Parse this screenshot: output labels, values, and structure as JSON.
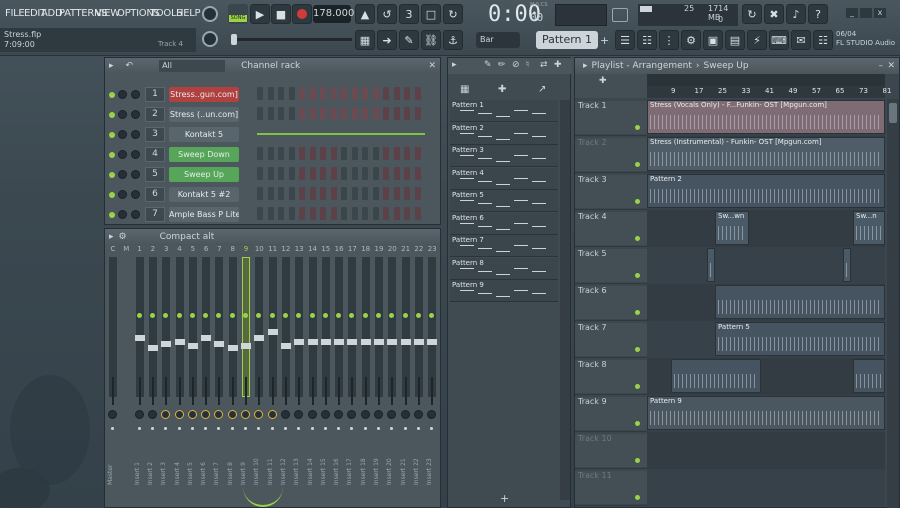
{
  "menu": [
    "FILE",
    "EDIT",
    "ADD",
    "PATTERNS",
    "VIEW",
    "OPTIONS",
    "TOOLS",
    "HELP"
  ],
  "song_badge": "SONG",
  "tempo": "178.000",
  "time": "0:00",
  "time_sub": "00",
  "time_unit": "M:S:CS",
  "cpu": "25",
  "mem": "1714 MB",
  "mem_sub": "0",
  "file": {
    "name": "Stress.flp",
    "time": "7:09:00",
    "track": "Track 4"
  },
  "snap": "Bar",
  "pattern_sel": "Pattern 1",
  "news": {
    "date": "06/04",
    "text": "FL STUDIO Audio f..."
  },
  "channel_rack": {
    "title": "Channel rack",
    "filter": "All",
    "channels": [
      {
        "num": "1",
        "name": "Stress..gun.com]",
        "color": "#b0413f"
      },
      {
        "num": "2",
        "name": "Stress (..un.com]",
        "color": "#59656c"
      },
      {
        "num": "3",
        "name": "Kontakt 5",
        "color": "#59656c"
      },
      {
        "num": "4",
        "name": "Sweep Down",
        "color": "#56a558"
      },
      {
        "num": "5",
        "name": "Sweep Up",
        "color": "#56a558"
      },
      {
        "num": "6",
        "name": "Kontakt 5 #2",
        "color": "#59656c"
      },
      {
        "num": "7",
        "name": "Ample Bass P Lite II",
        "color": "#59656c"
      }
    ]
  },
  "mixer": {
    "title": "Compact alt",
    "headers": [
      "C",
      "M",
      "1",
      "2",
      "3",
      "4",
      "5",
      "6",
      "7",
      "8",
      "9",
      "10",
      "11",
      "12",
      "13",
      "14",
      "15",
      "16",
      "17",
      "18",
      "19",
      "20",
      "21",
      "22",
      "23"
    ],
    "labels": [
      "Master",
      "Insert 1",
      "Insert 2",
      "Insert 3",
      "Insert 4",
      "Insert 5",
      "Insert 6",
      "Insert 7",
      "Insert 8",
      "Insert 9",
      "Insert 10",
      "Insert 11",
      "Insert 12",
      "Insert 13",
      "Insert 14",
      "Insert 15",
      "Insert 16",
      "Insert 17",
      "Insert 18",
      "Insert 19",
      "Insert 20",
      "Insert 21",
      "Insert 22",
      "Insert 23"
    ]
  },
  "patterns": [
    "Pattern 1",
    "Pattern 2",
    "Pattern 3",
    "Pattern 4",
    "Pattern 5",
    "Pattern 6",
    "Pattern 7",
    "Pattern 8",
    "Pattern 9"
  ],
  "playlist": {
    "title": "Playlist - Arrangement",
    "breadcrumb": "Sweep Up",
    "ruler": [
      "9",
      "17",
      "25",
      "33",
      "41",
      "49",
      "57",
      "65",
      "73",
      "81"
    ],
    "tracks": [
      "Track 1",
      "Track 2",
      "Track 3",
      "Track 4",
      "Track 5",
      "Track 6",
      "Track 7",
      "Track 8",
      "Track 9",
      "Track 10",
      "Track 11"
    ],
    "clips": {
      "t1": "Stress (Vocals Only) - F...Funkin- OST [Mpgun.com]",
      "t1b": "S...om]",
      "t2": "Stress (Instrumental) - Funkin- OST [Mpgun.com]",
      "t3": "Pattern 2",
      "t4": "Sw...wn",
      "t4b": "Sw...n",
      "t7": "Pattern 5",
      "t7b": "Pa...n 5",
      "t9": "Pattern 9",
      "t9b": "Pa...9"
    }
  },
  "colors": {
    "accent_green": "#9ad24a",
    "audio_pink": "#c7a0a8",
    "clip_blue": "#5b6a78"
  }
}
